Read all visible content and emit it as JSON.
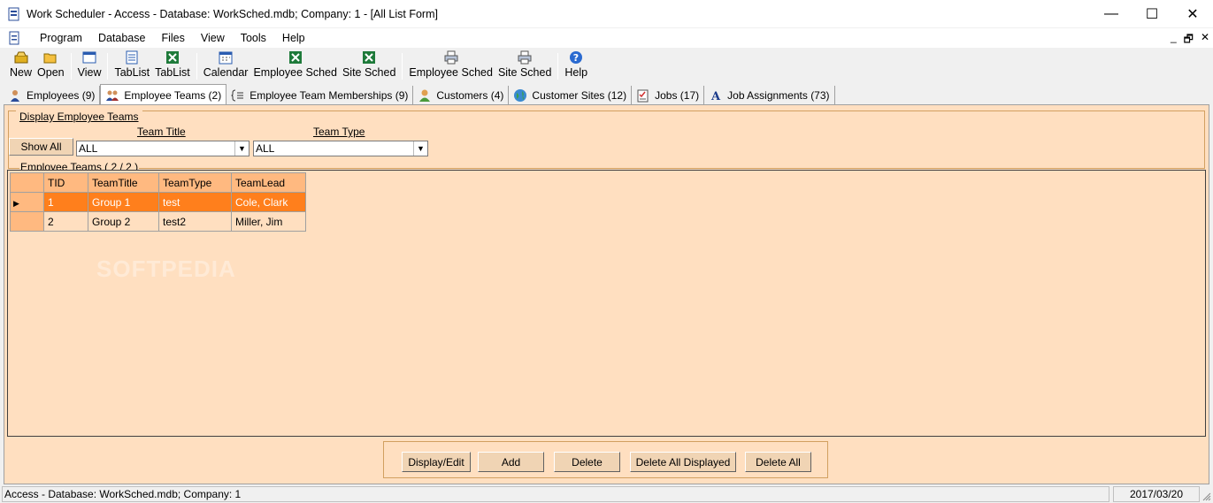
{
  "window": {
    "title": "Work Scheduler - Access - Database: WorkSched.mdb; Company: 1 - [All List Form]",
    "controls": {
      "minimize": "—",
      "maximize": "☐",
      "close": "✕"
    }
  },
  "menu": {
    "items": [
      "Program",
      "Database",
      "Files",
      "View",
      "Tools",
      "Help"
    ],
    "mdi_controls": {
      "minimize": "_",
      "restore": "🗗",
      "close": "✕"
    }
  },
  "toolbar": {
    "buttons": [
      {
        "label": "New",
        "icon": "new-folder-icon"
      },
      {
        "label": "Open",
        "icon": "open-folder-icon"
      },
      {
        "label": "View",
        "icon": "view-window-icon"
      },
      {
        "label": "TabList",
        "icon": "tablist-icon"
      },
      {
        "label": "TabList",
        "icon": "excel-icon"
      },
      {
        "label": "Calendar",
        "icon": "calendar-icon"
      },
      {
        "label": "Employee Sched",
        "icon": "excel-icon"
      },
      {
        "label": "Site Sched",
        "icon": "excel-icon"
      },
      {
        "label": "Employee Sched",
        "icon": "print-icon"
      },
      {
        "label": "Site Sched",
        "icon": "print-icon"
      },
      {
        "label": "Help",
        "icon": "help-icon"
      }
    ]
  },
  "tabs": [
    {
      "label": "Employees  (9)",
      "icon": "person-icon"
    },
    {
      "label": "Employee Teams (2)",
      "icon": "team-icon"
    },
    {
      "label": "Employee Team Memberships (9)",
      "icon": "membership-icon"
    },
    {
      "label": "Customers (4)",
      "icon": "customer-icon"
    },
    {
      "label": "Customer Sites (12)",
      "icon": "globe-icon"
    },
    {
      "label": "Jobs (17)",
      "icon": "jobs-icon"
    },
    {
      "label": "Job Assignments (73)",
      "icon": "assignment-icon"
    }
  ],
  "filter": {
    "group_title": "Display Employee Teams",
    "show_all": "Show All",
    "team_title_label": "Team Title",
    "team_title_value": "ALL",
    "team_type_label": "Team Type",
    "team_type_value": "ALL"
  },
  "grid": {
    "caption": "Employee Teams  ( 2 / 2 )",
    "columns": [
      "TID",
      "TeamTitle",
      "TeamType",
      "TeamLead"
    ],
    "rows": [
      [
        "1",
        "Group 1",
        "test",
        "Cole, Clark"
      ],
      [
        "2",
        "Group 2",
        "test2",
        "Miller, Jim"
      ]
    ],
    "watermark": "SOFTPEDIA"
  },
  "actions": {
    "display_edit": "Display/Edit",
    "add": "Add",
    "delete": "Delete",
    "delete_all_displayed": "Delete All Displayed",
    "delete_all": "Delete All"
  },
  "status": {
    "left": "Access - Database: WorkSched.mdb; Company: 1",
    "right": "2017/03/20"
  },
  "colors": {
    "content_bg": "#ffdfc0",
    "header_bg": "#ffb980",
    "selected_row": "#ff7f1c"
  }
}
